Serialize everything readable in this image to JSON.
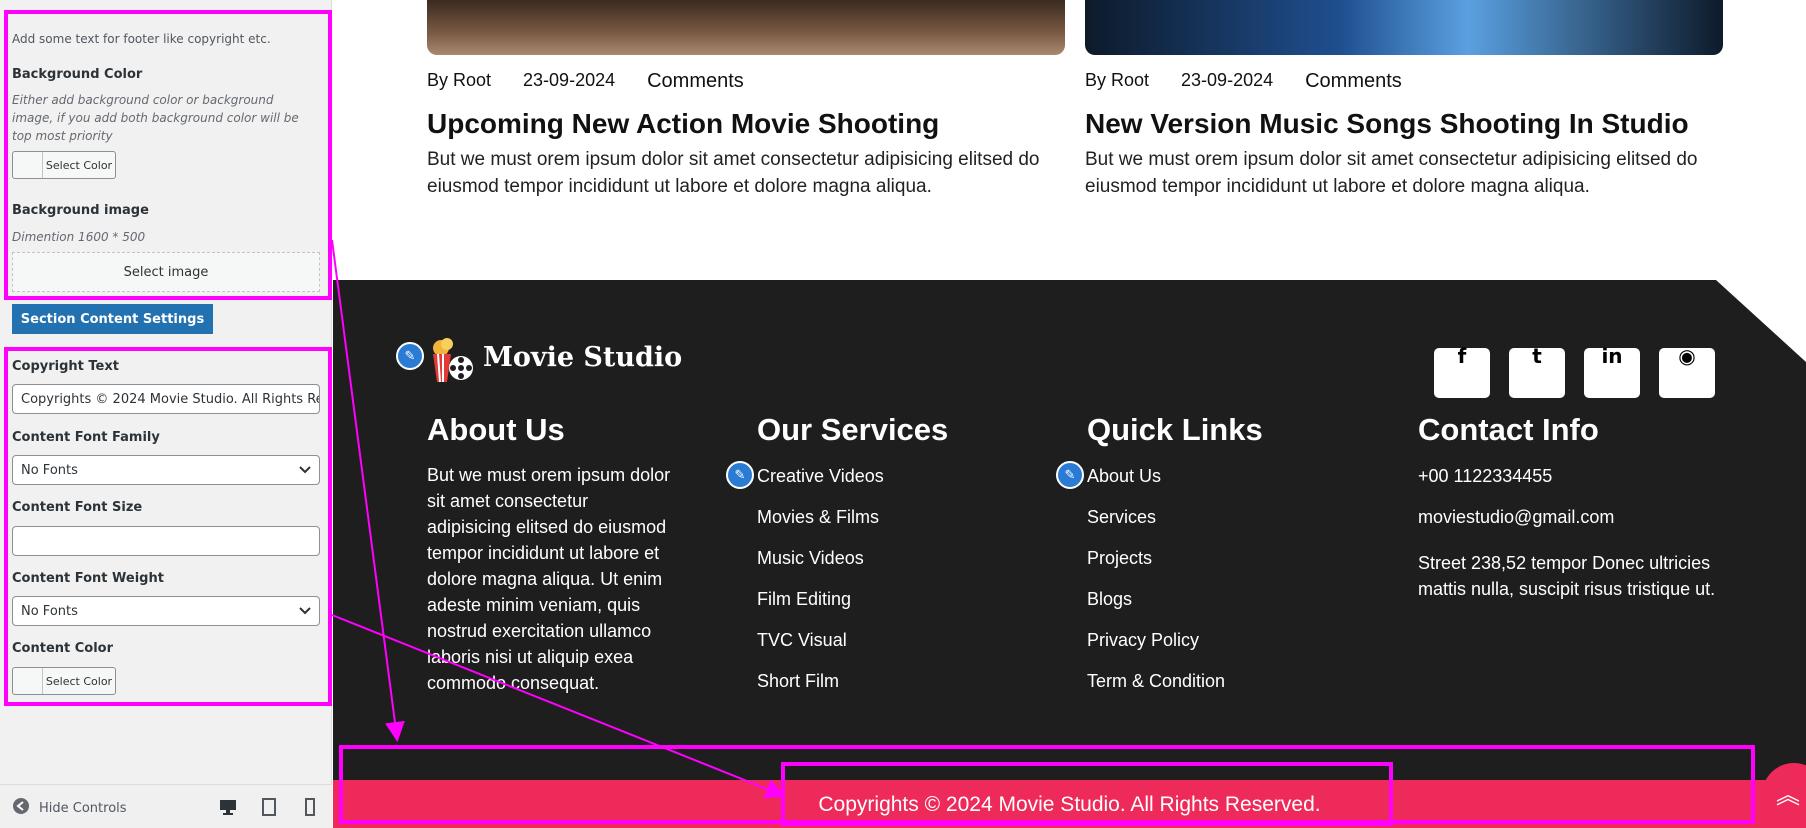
{
  "panel": {
    "footer_hint": "Add some text for footer like copyright etc.",
    "bg_color_label": "Background Color",
    "bg_color_desc": "Either add background color or background image, if you add both background color will be top most priority",
    "select_color": "Select Color",
    "bg_image_label": "Background image",
    "bg_image_desc": "Dimention 1600 * 500",
    "select_image": "Select image",
    "section_content_settings": "Section Content Settings",
    "copyright_label": "Copyright Text",
    "copyright_value": "Copyrights © 2024 Movie Studio. All Rights Reserved.",
    "font_family_label": "Content Font Family",
    "font_family_value": "No Fonts",
    "font_size_label": "Content Font Size",
    "font_size_value": "",
    "font_weight_label": "Content Font Weight",
    "font_weight_value": "No Fonts",
    "content_color_label": "Content Color",
    "hide_controls": "Hide Controls"
  },
  "posts": [
    {
      "author": "By Root",
      "date": "23-09-2024",
      "comments": "Comments",
      "title": "Upcoming New Action Movie Shooting",
      "excerpt": "But we must orem ipsum dolor sit amet consectetur adipisicing elitsed do eiusmod tempor incididunt ut labore et dolore magna aliqua."
    },
    {
      "author": "By Root",
      "date": "23-09-2024",
      "comments": "Comments",
      "title": "New Version Music Songs Shooting In Studio",
      "excerpt": "But we must orem ipsum dolor sit amet consectetur adipisicing elitsed do eiusmod tempor incididunt ut labore et dolore magna aliqua."
    }
  ],
  "footer": {
    "logo_text": "Movie Studio",
    "social": [
      "f",
      "t",
      "in",
      "◉"
    ],
    "about_title": "About Us",
    "about_text": "But we must orem ipsum dolor sit amet consectetur adipisicing elitsed do eiusmod tempor incididunt ut labore et dolore magna aliqua. Ut enim adeste minim veniam, quis nostrud exercitation ullamco laboris nisi ut aliquip exea commodo consequat.",
    "services_title": "Our Services",
    "services": [
      "Creative Videos",
      "Movies & Films",
      "Music Videos",
      "Film Editing",
      "TVC Visual",
      "Short Film"
    ],
    "links_title": "Quick Links",
    "links": [
      "About Us",
      "Services",
      "Projects",
      "Blogs",
      "Privacy Policy",
      "Term & Condition"
    ],
    "contact_title": "Contact Info",
    "phone": "+00 1122334455",
    "email": "moviestudio@gmail.com",
    "address": "Street 238,52 tempor Donec ultricies mattis nulla, suscipit risus tristique ut.",
    "copyright": "Copyrights © 2024 Movie Studio. All Rights Reserved."
  },
  "colors": {
    "footer_bg": "#1e1e1e",
    "copyright_bar": "#ee2a5a",
    "accent_button": "#2271b1",
    "highlight": "#ff00ff",
    "edit_pen": "#2a7bd4"
  },
  "icons": [
    "pencil-icon",
    "chevron-down-icon",
    "eye-icon",
    "desktop-icon",
    "tablet-icon",
    "mobile-icon",
    "facebook-icon",
    "twitter-icon",
    "linkedin-icon",
    "dribbble-icon",
    "double-chevron-up-icon"
  ]
}
